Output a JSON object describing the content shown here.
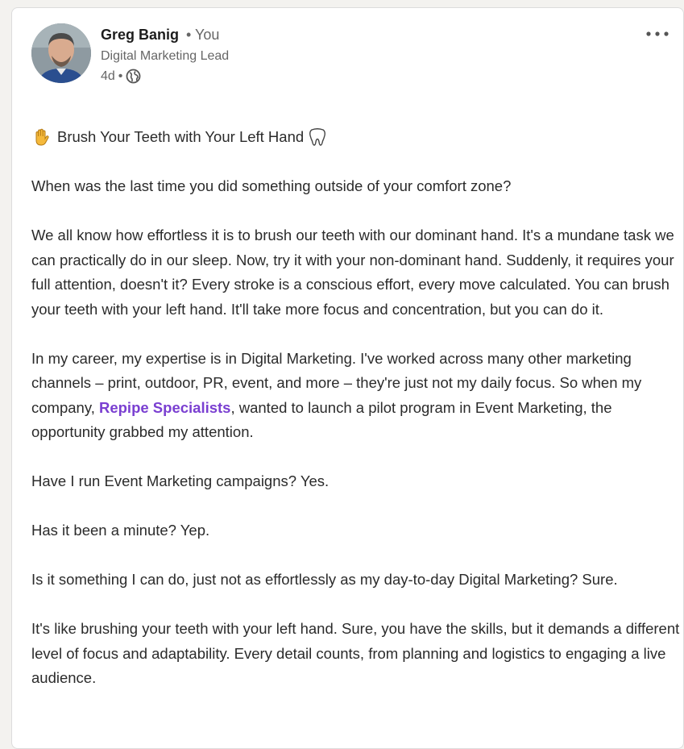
{
  "post": {
    "author": {
      "name": "Greg Banig",
      "separator": "•",
      "relation": "You",
      "headline": "Digital Marketing Lead",
      "age": "4d",
      "age_separator": "•",
      "avatar_icon": "profile-photo",
      "visibility_icon": "globe-icon"
    },
    "menu_label": "•••",
    "title": "Brush Your Teeth with Your Left Hand",
    "title_leading_icon": "raised-hand-icon",
    "title_trailing_icon": "tooth-icon",
    "paragraphs": {
      "p1": "When was the last time you did something outside of your comfort zone?",
      "p2": "We all know how effortless it is to brush our teeth with our dominant hand. It's a mundane task we can practically do in our sleep. Now, try it with your non-dominant hand. Suddenly, it requires your full attention, doesn't it? Every stroke is a conscious effort, every move calculated. You can brush your teeth with your left hand. It'll take more focus and concentration, but you can do it.",
      "p3_before": "In my career, my expertise is in Digital Marketing. I've worked across many other marketing channels – print, outdoor, PR, event, and more – they're just not my daily focus. So when my company, ",
      "p3_mention": "Repipe Specialists",
      "p3_after": ", wanted to launch a pilot program in Event Marketing, the opportunity grabbed my attention.",
      "p4": "Have I run Event Marketing campaigns? Yes.",
      "p5": "Has it been a minute? Yep.",
      "p6": "Is it something I can do, just not as effortlessly as my day-to-day Digital Marketing? Sure.",
      "p7": "It's like brushing your teeth with your left hand. Sure, you have the skills, but it demands a different level of focus and adaptability. Every detail counts, from planning and logistics to engaging a live audience."
    },
    "colors": {
      "mention": "#7a3fd1",
      "text": "#2b2b2b",
      "muted": "#666666"
    }
  }
}
